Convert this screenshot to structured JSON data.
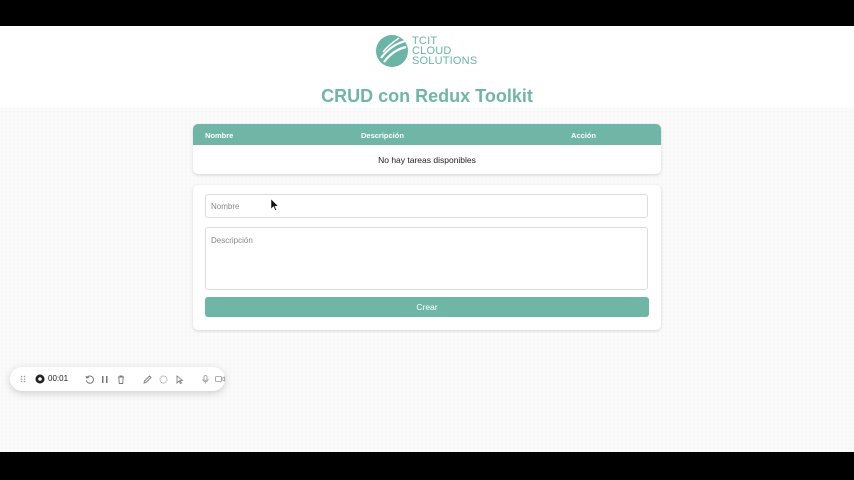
{
  "logo": {
    "line1": "TCIT",
    "line2": "CLOUD",
    "line3": "SOLUTIONS"
  },
  "page": {
    "title": "CRUD con Redux Toolkit"
  },
  "table": {
    "columns": [
      "Nombre",
      "Descripción",
      "Acción"
    ],
    "empty_text": "No hay tareas disponibles"
  },
  "form": {
    "name_placeholder": "Nombre",
    "name_value": "",
    "description_placeholder": "Descripción",
    "description_value": "",
    "submit_label": "Crear"
  },
  "recorder": {
    "elapsed": "00:01",
    "icons": [
      "drag-handle-icon",
      "record-icon",
      "restart-icon",
      "pause-icon",
      "trash-icon",
      "pen-icon",
      "spotlight-icon",
      "cursor-highlight-icon",
      "microphone-icon",
      "camera-icon"
    ]
  },
  "colors": {
    "brand": "#6fb6a7",
    "brand_text": "#6ab5a5",
    "background": "#fafafa"
  }
}
